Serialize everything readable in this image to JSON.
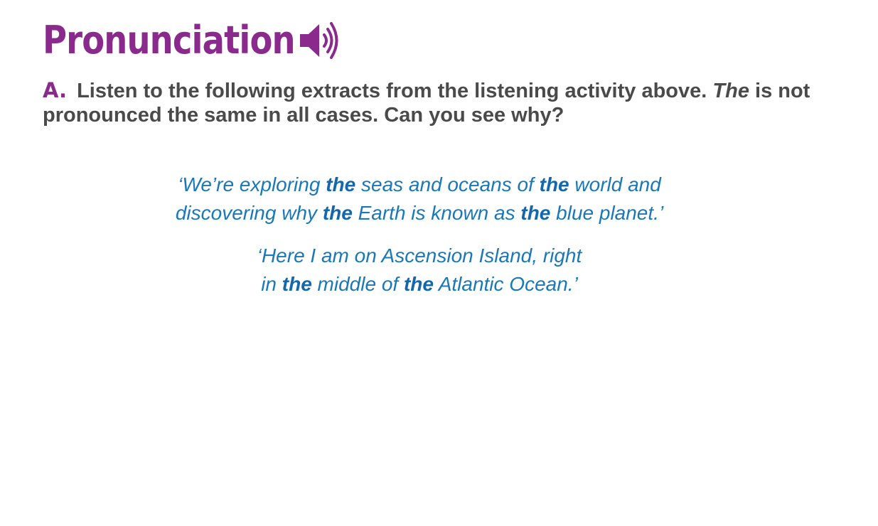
{
  "heading": {
    "title": "Pronunciation",
    "audio_icon": "speaker-volume-icon"
  },
  "instruction": {
    "letter": "A.",
    "text_part1": "Listen to the following extracts from the listening activity above.",
    "italic_word": "The",
    "text_part2": "is not pronounced the same in all cases. Can you see why?"
  },
  "quotes": [
    {
      "lines": [
        [
          "‘We’re exploring ",
          "the",
          " seas and oceans of ",
          "the",
          " world and"
        ],
        [
          "discovering why ",
          "the",
          " Earth is known as ",
          "the",
          " blue planet.’"
        ]
      ]
    },
    {
      "lines": [
        [
          "‘Here I am on Ascension Island, right"
        ],
        [
          "in ",
          "the",
          " middle of ",
          "the",
          " Atlantic Ocean.’"
        ]
      ]
    }
  ],
  "colors": {
    "title": "#8a2a8c",
    "instruction": "#4a4a4a",
    "quote": "#1a78b9"
  }
}
